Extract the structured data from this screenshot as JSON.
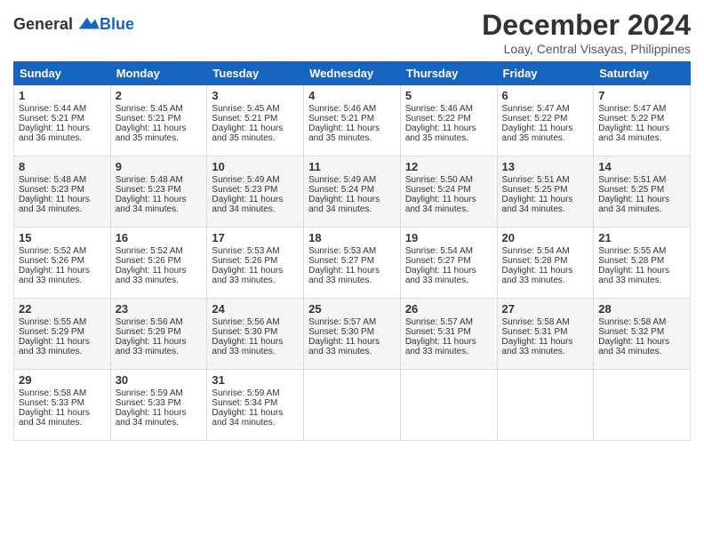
{
  "logo": {
    "general": "General",
    "blue": "Blue"
  },
  "title": "December 2024",
  "location": "Loay, Central Visayas, Philippines",
  "days_of_week": [
    "Sunday",
    "Monday",
    "Tuesday",
    "Wednesday",
    "Thursday",
    "Friday",
    "Saturday"
  ],
  "weeks": [
    [
      {
        "day": "1",
        "sunrise": "5:44 AM",
        "sunset": "5:21 PM",
        "daylight": "11 hours and 36 minutes."
      },
      {
        "day": "2",
        "sunrise": "5:45 AM",
        "sunset": "5:21 PM",
        "daylight": "11 hours and 35 minutes."
      },
      {
        "day": "3",
        "sunrise": "5:45 AM",
        "sunset": "5:21 PM",
        "daylight": "11 hours and 35 minutes."
      },
      {
        "day": "4",
        "sunrise": "5:46 AM",
        "sunset": "5:21 PM",
        "daylight": "11 hours and 35 minutes."
      },
      {
        "day": "5",
        "sunrise": "5:46 AM",
        "sunset": "5:22 PM",
        "daylight": "11 hours and 35 minutes."
      },
      {
        "day": "6",
        "sunrise": "5:47 AM",
        "sunset": "5:22 PM",
        "daylight": "11 hours and 35 minutes."
      },
      {
        "day": "7",
        "sunrise": "5:47 AM",
        "sunset": "5:22 PM",
        "daylight": "11 hours and 34 minutes."
      }
    ],
    [
      {
        "day": "8",
        "sunrise": "5:48 AM",
        "sunset": "5:23 PM",
        "daylight": "11 hours and 34 minutes."
      },
      {
        "day": "9",
        "sunrise": "5:48 AM",
        "sunset": "5:23 PM",
        "daylight": "11 hours and 34 minutes."
      },
      {
        "day": "10",
        "sunrise": "5:49 AM",
        "sunset": "5:23 PM",
        "daylight": "11 hours and 34 minutes."
      },
      {
        "day": "11",
        "sunrise": "5:49 AM",
        "sunset": "5:24 PM",
        "daylight": "11 hours and 34 minutes."
      },
      {
        "day": "12",
        "sunrise": "5:50 AM",
        "sunset": "5:24 PM",
        "daylight": "11 hours and 34 minutes."
      },
      {
        "day": "13",
        "sunrise": "5:51 AM",
        "sunset": "5:25 PM",
        "daylight": "11 hours and 34 minutes."
      },
      {
        "day": "14",
        "sunrise": "5:51 AM",
        "sunset": "5:25 PM",
        "daylight": "11 hours and 34 minutes."
      }
    ],
    [
      {
        "day": "15",
        "sunrise": "5:52 AM",
        "sunset": "5:26 PM",
        "daylight": "11 hours and 33 minutes."
      },
      {
        "day": "16",
        "sunrise": "5:52 AM",
        "sunset": "5:26 PM",
        "daylight": "11 hours and 33 minutes."
      },
      {
        "day": "17",
        "sunrise": "5:53 AM",
        "sunset": "5:26 PM",
        "daylight": "11 hours and 33 minutes."
      },
      {
        "day": "18",
        "sunrise": "5:53 AM",
        "sunset": "5:27 PM",
        "daylight": "11 hours and 33 minutes."
      },
      {
        "day": "19",
        "sunrise": "5:54 AM",
        "sunset": "5:27 PM",
        "daylight": "11 hours and 33 minutes."
      },
      {
        "day": "20",
        "sunrise": "5:54 AM",
        "sunset": "5:28 PM",
        "daylight": "11 hours and 33 minutes."
      },
      {
        "day": "21",
        "sunrise": "5:55 AM",
        "sunset": "5:28 PM",
        "daylight": "11 hours and 33 minutes."
      }
    ],
    [
      {
        "day": "22",
        "sunrise": "5:55 AM",
        "sunset": "5:29 PM",
        "daylight": "11 hours and 33 minutes."
      },
      {
        "day": "23",
        "sunrise": "5:56 AM",
        "sunset": "5:29 PM",
        "daylight": "11 hours and 33 minutes."
      },
      {
        "day": "24",
        "sunrise": "5:56 AM",
        "sunset": "5:30 PM",
        "daylight": "11 hours and 33 minutes."
      },
      {
        "day": "25",
        "sunrise": "5:57 AM",
        "sunset": "5:30 PM",
        "daylight": "11 hours and 33 minutes."
      },
      {
        "day": "26",
        "sunrise": "5:57 AM",
        "sunset": "5:31 PM",
        "daylight": "11 hours and 33 minutes."
      },
      {
        "day": "27",
        "sunrise": "5:58 AM",
        "sunset": "5:31 PM",
        "daylight": "11 hours and 33 minutes."
      },
      {
        "day": "28",
        "sunrise": "5:58 AM",
        "sunset": "5:32 PM",
        "daylight": "11 hours and 34 minutes."
      }
    ],
    [
      {
        "day": "29",
        "sunrise": "5:58 AM",
        "sunset": "5:33 PM",
        "daylight": "11 hours and 34 minutes."
      },
      {
        "day": "30",
        "sunrise": "5:59 AM",
        "sunset": "5:33 PM",
        "daylight": "11 hours and 34 minutes."
      },
      {
        "day": "31",
        "sunrise": "5:59 AM",
        "sunset": "5:34 PM",
        "daylight": "11 hours and 34 minutes."
      },
      null,
      null,
      null,
      null
    ]
  ],
  "labels": {
    "sunrise": "Sunrise:",
    "sunset": "Sunset:",
    "daylight": "Daylight:"
  }
}
